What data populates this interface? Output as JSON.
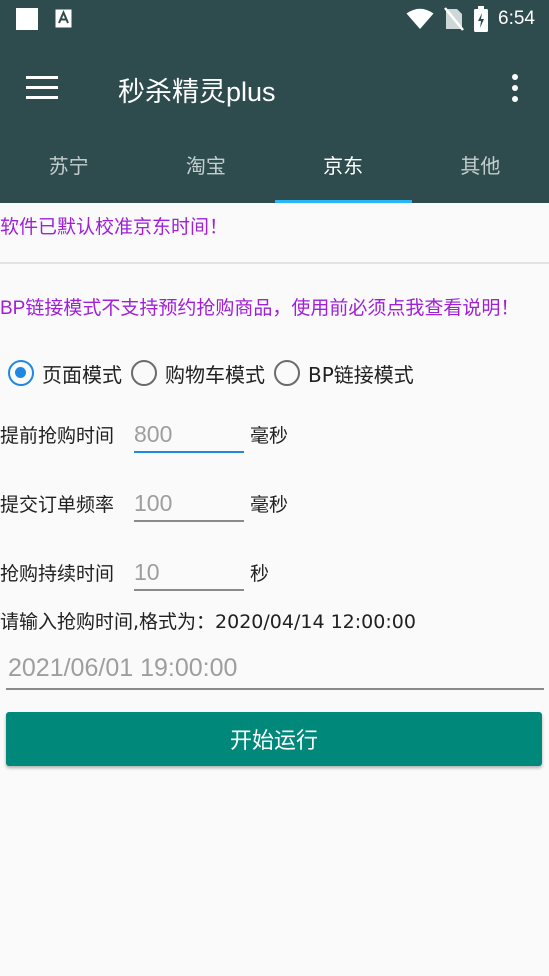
{
  "status_bar": {
    "time": "6:54"
  },
  "app_bar": {
    "title": "秒杀精灵plus"
  },
  "tabs": [
    {
      "label": "苏宁"
    },
    {
      "label": "淘宝"
    },
    {
      "label": "京东"
    },
    {
      "label": "其他"
    }
  ],
  "selected_tab": "京东",
  "notices": {
    "calibration": "软件已默认校准京东时间！",
    "bp_warning": "BP链接模式不支持预约抢购商品，使用前必须点我查看说明！"
  },
  "modes": {
    "options": [
      "页面模式",
      "购物车模式",
      "BP链接模式"
    ],
    "selected": "页面模式"
  },
  "fields": {
    "advance": {
      "label": "提前抢购时间",
      "placeholder": "800",
      "unit": "毫秒"
    },
    "frequency": {
      "label": "提交订单频率",
      "placeholder": "100",
      "unit": "毫秒"
    },
    "duration": {
      "label": "抢购持续时间",
      "placeholder": "10",
      "unit": "秒"
    }
  },
  "time_input": {
    "hint": "请输入抢购时间,格式为：2020/04/14 12:00:00",
    "placeholder": "2021/06/01 19:00:00"
  },
  "start_button": {
    "label": "开始运行"
  },
  "colors": {
    "app_bar": "#2e4c4e",
    "tab_indicator": "#29b6f6",
    "notice_text": "#a020d8",
    "radio_selected": "#1e88e5",
    "button": "#00897b"
  }
}
